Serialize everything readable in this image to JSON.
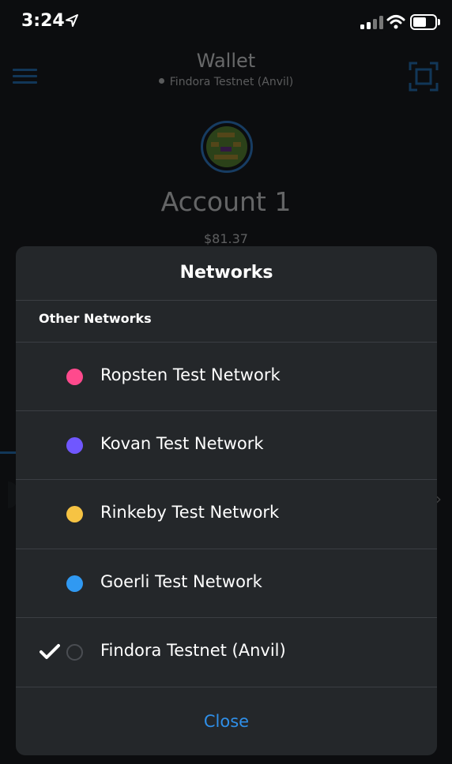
{
  "status_bar": {
    "time": "3:24"
  },
  "wallet": {
    "title": "Wallet",
    "network": "Findora Testnet (Anvil)",
    "account_name": "Account 1",
    "balance": "$81.37"
  },
  "modal": {
    "title": "Networks",
    "section_header": "Other Networks",
    "networks": [
      {
        "label": "Ropsten Test Network",
        "color": "#ff4a8d",
        "selected": false
      },
      {
        "label": "Kovan Test Network",
        "color": "#7057ff",
        "selected": false
      },
      {
        "label": "Rinkeby Test Network",
        "color": "#f6c343",
        "selected": false
      },
      {
        "label": "Goerli Test Network",
        "color": "#3099f2",
        "selected": false
      },
      {
        "label": "Findora Testnet (Anvil)",
        "color": "",
        "selected": true
      }
    ],
    "close_label": "Close"
  },
  "colors": {
    "accent": "#2f8fe8",
    "modal_bg": "#24272a",
    "page_bg": "#0c0d0f"
  }
}
